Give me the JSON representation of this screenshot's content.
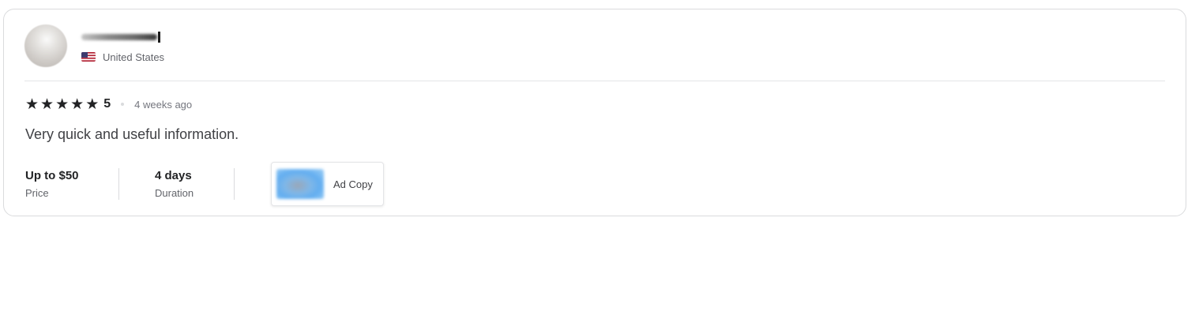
{
  "reviewer": {
    "country": "United States",
    "flag_colors": [
      "#b22234",
      "#ffffff",
      "#3c3b6e"
    ]
  },
  "review": {
    "rating": 5,
    "rating_label": "5",
    "stars_filled": 5,
    "stars_total": 5,
    "time_ago": "4 weeks ago",
    "text": "Very quick and useful information."
  },
  "details": [
    {
      "value": "Up to $50",
      "label": "Price"
    },
    {
      "value": "4 days",
      "label": "Duration"
    }
  ],
  "service": {
    "name": "Ad Copy"
  },
  "colors": {
    "text_primary": "#222325",
    "text_secondary": "#62646a",
    "border": "#dadbdd"
  }
}
